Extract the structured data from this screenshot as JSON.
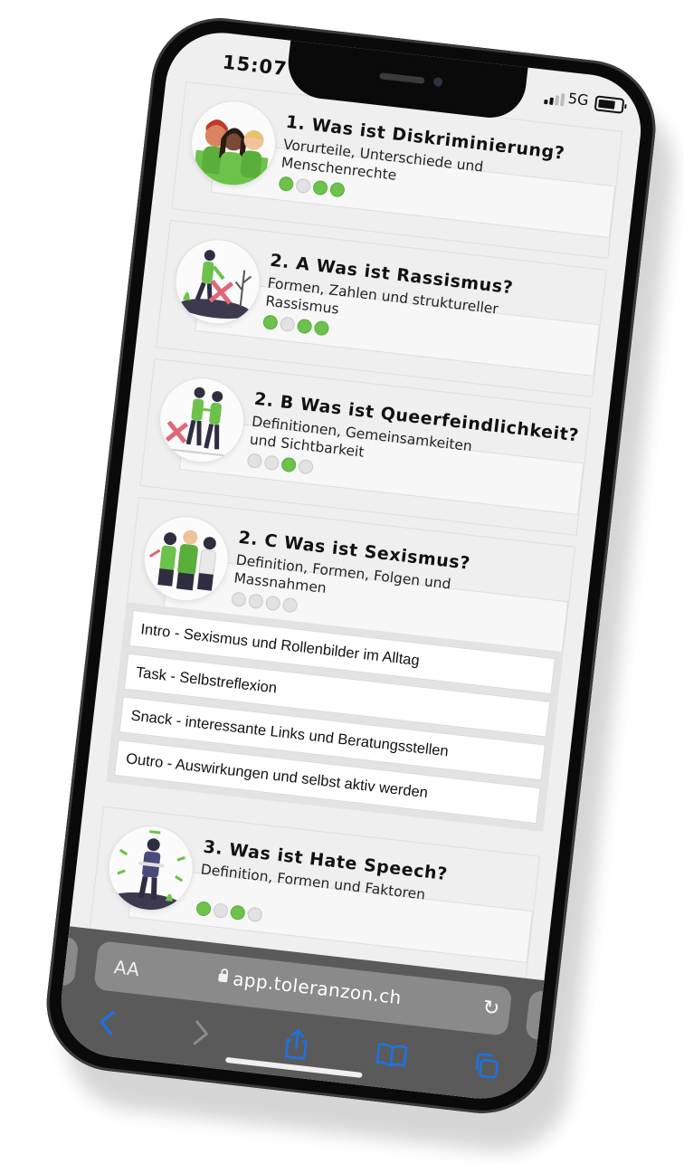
{
  "status_bar": {
    "time": "15:07",
    "network": "5G"
  },
  "modules": [
    {
      "title": "1. Was ist Diskriminierung?",
      "description": "Vorurteile, Unterschiede und Menschenrechte",
      "progress": [
        true,
        false,
        true,
        true
      ]
    },
    {
      "title": "2. A Was ist Rassismus?",
      "description": "Formen, Zahlen und struktureller Rassismus",
      "progress": [
        true,
        false,
        true,
        true
      ]
    },
    {
      "title": "2. B Was ist Queerfeindlichkeit?",
      "description": "Definitionen, Gemeinsamkeiten und Sichtbarkeit",
      "progress": [
        false,
        false,
        true,
        false
      ]
    },
    {
      "title": "2. C Was ist Sexismus?",
      "description": "Definition, Formen, Folgen und Massnahmen",
      "progress": [
        false,
        false,
        false,
        false
      ]
    }
  ],
  "sexismus_lessons": [
    "Intro - Sexismus und Rollenbilder im Alltag",
    "Task - Selbstreflexion",
    "Snack - interessante Links und Beratungsstellen",
    "Outro - Auswirkungen und selbst aktiv werden"
  ],
  "hate_speech_module": {
    "title": "3. Was ist Hate Speech?",
    "description": "Definition, Formen und Faktoren",
    "progress": [
      true,
      false,
      true,
      false
    ]
  },
  "browser": {
    "text_size_label": "AA",
    "url": "app.toleranzon.ch"
  },
  "colors": {
    "progress_done": "#6cc24a",
    "progress_todo": "#e2e2e2",
    "accent_green": "#6cc24a",
    "browser_blue": "#1a73e8"
  }
}
